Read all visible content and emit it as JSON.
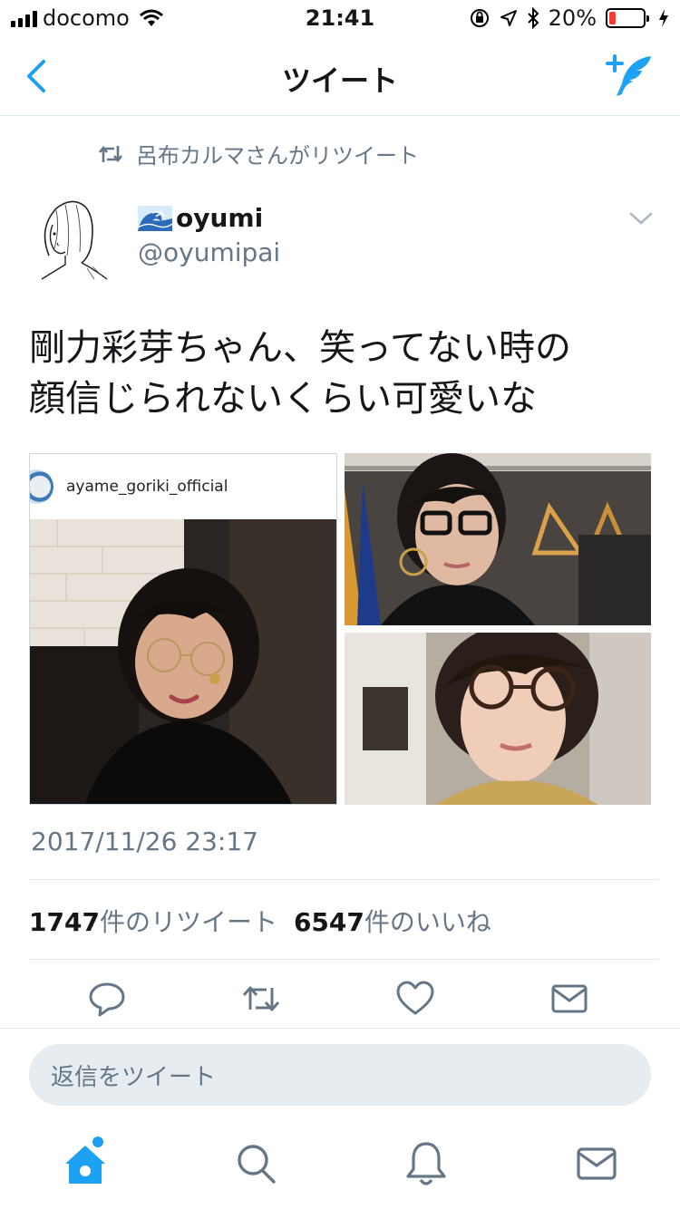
{
  "status_bar": {
    "carrier": "docomo",
    "time": "21:41",
    "battery_percent": "20%",
    "battery_level": 0.2,
    "battery_color": "#ff3b30",
    "icons": [
      "signal-bars-icon",
      "wifi-icon",
      "orientation-lock-icon",
      "location-icon",
      "bluetooth-icon",
      "battery-icon",
      "charging-icon"
    ]
  },
  "nav": {
    "title": "ツイート",
    "back_icon": "chevron-left-icon",
    "compose_icon": "compose-tweet-icon"
  },
  "retweet_context": {
    "text": "呂布カルマさんがリツイート",
    "icon": "retweet-icon"
  },
  "author": {
    "emoji_icon": "wave-icon",
    "name": "oyumi",
    "handle": "@oyumipai"
  },
  "tweet": {
    "text_line1": "剛力彩芽ちゃん、笑ってない時の",
    "text_line2": "顔信じられないくらい可愛いな",
    "timestamp": "2017/11/26 23:17",
    "media": {
      "left_caption": "ayame_goriki_official"
    }
  },
  "stats": {
    "retweets_count": "1747",
    "retweets_label": "件のリツイート",
    "likes_count": "6547",
    "likes_label": "件のいいね"
  },
  "actions": [
    "reply-icon",
    "retweet-icon",
    "like-icon",
    "share-icon"
  ],
  "reply_box": {
    "placeholder": "返信をツイート"
  },
  "tabbar": {
    "items": [
      "home-icon",
      "search-icon",
      "notifications-icon",
      "messages-icon"
    ]
  },
  "colors": {
    "accent": "#1da1f2",
    "secondary_text": "#657786",
    "divider": "#e1e8ed"
  }
}
